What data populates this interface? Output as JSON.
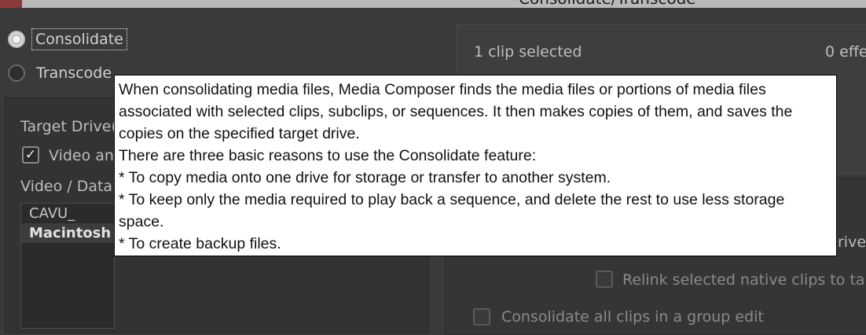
{
  "window": {
    "title": "Consolidate/Transcode"
  },
  "mode": {
    "consolidate_label": "Consolidate",
    "transcode_label": "Transcode",
    "selected": "Consolidate"
  },
  "left": {
    "target_drive_label": "Target Drive(",
    "video_checkbox_label": "Video an",
    "video_data_label": "Video / Data",
    "drives": [
      "CAVU_",
      "Macintosh"
    ]
  },
  "right": {
    "clips_selected": "1 clip selected",
    "effects_count": "0 effe",
    "drive_partial": "rive",
    "relink_label": "Relink selected native clips to targ",
    "group_edit_label": "Consolidate all clips in a group edit"
  },
  "tooltip": {
    "lines": [
      "When consolidating media files, Media Composer finds the media files or portions of media files",
      "associated with selected clips, subclips, or sequences. It then makes copies of them, and saves the",
      "copies on the specified target drive.",
      "There are three basic reasons to use the Consolidate feature:",
      "* To copy media onto one drive for storage or transfer to another system.",
      "* To keep only the media required to play back a sequence, and delete the rest to use less storage",
      "space.",
      "* To create backup files."
    ]
  }
}
